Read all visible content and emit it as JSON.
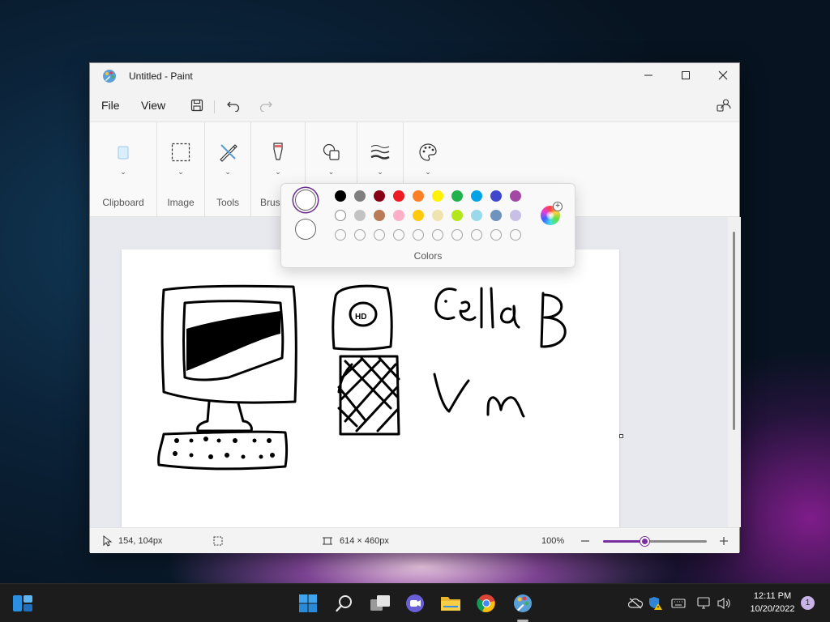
{
  "window": {
    "title": "Untitled - Paint"
  },
  "menubar": {
    "file": "File",
    "view": "View"
  },
  "ribbon": {
    "groups": [
      {
        "label": "Clipboard",
        "icon": "clipboard-icon"
      },
      {
        "label": "Image",
        "icon": "selection-icon"
      },
      {
        "label": "Tools",
        "icon": "tools-icon"
      },
      {
        "label": "Brus",
        "icon": "brush-icon"
      },
      {
        "label": "",
        "icon": "shapes-icon"
      },
      {
        "label": "",
        "icon": "stroke-size-icon"
      },
      {
        "label": "",
        "icon": "palette-icon"
      }
    ]
  },
  "colors_flyout": {
    "label": "Colors",
    "primary_color": "#ffffff",
    "secondary_color": "#ffffff",
    "palette_row1": [
      "#000000",
      "#7f7f7f",
      "#880015",
      "#ed1c24",
      "#ff7f27",
      "#fff200",
      "#22b14c",
      "#00a2e8",
      "#3f48cc",
      "#a349a4"
    ],
    "palette_row2": [
      "#ffffff",
      "#c3c3c3",
      "#b97a57",
      "#ffaec9",
      "#ffc90e",
      "#efe4b0",
      "#b5e61d",
      "#99d9ea",
      "#7092be",
      "#c8bfe7"
    ],
    "custom_slots": 10
  },
  "canvas": {
    "drawn_text": [
      "Cella B",
      "Vm"
    ],
    "drawn_objects": [
      "computer-monitor",
      "keyboard",
      "computer-tower"
    ]
  },
  "statusbar": {
    "cursor_position": "154, 104px",
    "canvas_size": "614 × 460px",
    "zoom": "100%",
    "zoom_slider_level": 0.4,
    "accent_color": "#7b2e9e"
  },
  "taskbar": {
    "apps": [
      "widgets-icon",
      "start-icon",
      "search-icon",
      "task-view-icon",
      "chat-icon",
      "file-explorer-icon",
      "chrome-icon",
      "paint-icon"
    ],
    "time": "12:11 PM",
    "date": "10/20/2022",
    "notification_count": "1"
  }
}
